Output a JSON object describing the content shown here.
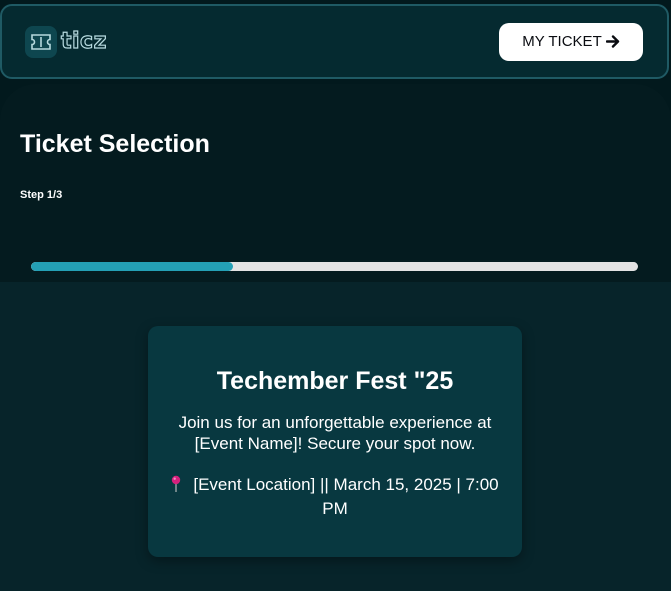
{
  "header": {
    "logo_text": "ticz",
    "my_ticket_label": "MY TICKET",
    "arrow_icon": "arrow-right-icon"
  },
  "progress": {
    "title": "Ticket Selection",
    "step_label": "Step 1/3",
    "fraction": 0.333
  },
  "event": {
    "title": "Techember Fest \"25",
    "description": "Join us for an unforgettable experience at [Event Name]! Secure your spot now.",
    "pin_icon": "location-pin-icon",
    "details": "[Event Location] || March 15, 2025 | 7:00 PM"
  },
  "colors": {
    "accent": "#24a0b5",
    "page_background": "#02191d",
    "card_background": "#083840",
    "pin": "#d6207d"
  }
}
